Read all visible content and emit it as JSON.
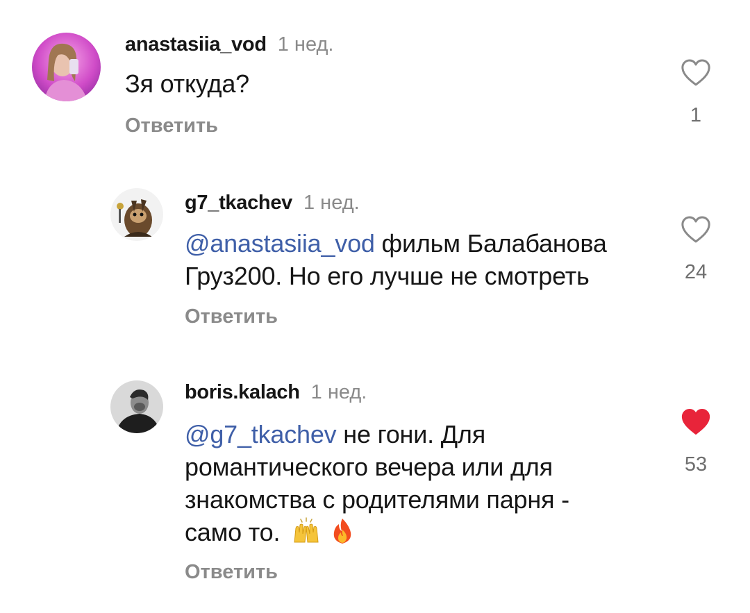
{
  "comments": [
    {
      "username": "anastasiia_vod",
      "time": "1 нед.",
      "text": "Зя откуда?",
      "reply_label": "Ответить",
      "likes": "1",
      "liked": false
    },
    {
      "username": "g7_tkachev",
      "time": "1 нед.",
      "mention": "@anastasiia_vod",
      "text_line1": " фильм Балабанова",
      "text_line2": "Груз200. Но его лучше не смотреть",
      "reply_label": "Ответить",
      "likes": "24",
      "liked": false
    },
    {
      "username": "boris.kalach",
      "time": "1 нед.",
      "mention": "@g7_tkachev",
      "text_line1": " не гони. Для",
      "text_line2": "романтического вечера или для",
      "text_line3": "знакомства с родителями парня -",
      "text_line4": "само то.",
      "emojis": [
        "raising-hands",
        "fire"
      ],
      "reply_label": "Ответить",
      "likes": "53",
      "liked": true
    }
  ],
  "colors": {
    "mention": "#3f5fa8",
    "liked_heart": "#e8243a",
    "muted": "#8a8a8a"
  }
}
